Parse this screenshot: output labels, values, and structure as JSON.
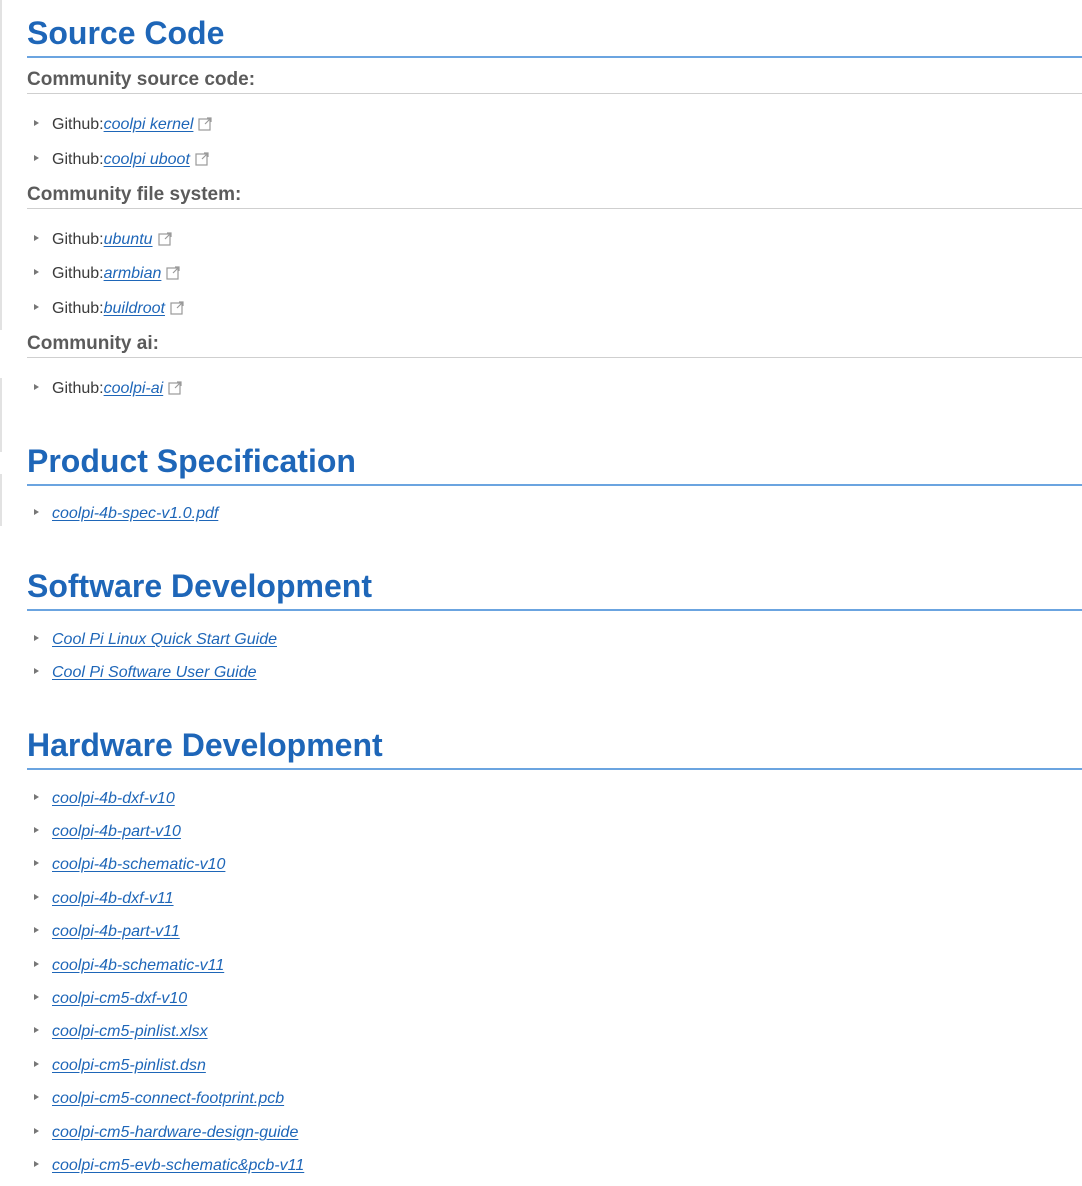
{
  "sections": {
    "source_code": {
      "title": "Source Code",
      "community_source_code": {
        "heading": "Community source code:",
        "items": [
          {
            "prefix": "Github:",
            "label": "coolpi kernel"
          },
          {
            "prefix": "Github:",
            "label": "coolpi uboot"
          }
        ]
      },
      "community_file_system": {
        "heading": "Community file system:",
        "items": [
          {
            "prefix": "Github:",
            "label": "ubuntu"
          },
          {
            "prefix": "Github:",
            "label": "armbian"
          },
          {
            "prefix": "Github:",
            "label": "buildroot"
          }
        ]
      },
      "community_ai": {
        "heading": "Community ai:",
        "items": [
          {
            "prefix": "Github:",
            "label": "coolpi-ai"
          }
        ]
      }
    },
    "product_specification": {
      "title": "Product Specification",
      "items": [
        {
          "label": "coolpi-4b-spec-v1.0.pdf"
        }
      ]
    },
    "software_development": {
      "title": "Software Development",
      "items": [
        {
          "label": "Cool Pi Linux Quick Start Guide"
        },
        {
          "label": "Cool Pi Software User Guide"
        }
      ]
    },
    "hardware_development": {
      "title": "Hardware Development",
      "items": [
        {
          "label": "coolpi-4b-dxf-v10"
        },
        {
          "label": "coolpi-4b-part-v10"
        },
        {
          "label": "coolpi-4b-schematic-v10"
        },
        {
          "label": "coolpi-4b-dxf-v11"
        },
        {
          "label": "coolpi-4b-part-v11"
        },
        {
          "label": "coolpi-4b-schematic-v11"
        },
        {
          "label": "coolpi-cm5-dxf-v10"
        },
        {
          "label": "coolpi-cm5-pinlist.xlsx"
        },
        {
          "label": "coolpi-cm5-pinlist.dsn"
        },
        {
          "label": "coolpi-cm5-connect-footprint.pcb"
        },
        {
          "label": "coolpi-cm5-hardware-design-guide"
        },
        {
          "label": "coolpi-cm5-evb-schematic&pcb-v11"
        }
      ]
    }
  },
  "icons": {
    "bullet": "triangle-right-icon",
    "external": "external-link-icon"
  },
  "colors": {
    "heading": "#1e66b8",
    "link": "#1e66b8",
    "heading_rule": "#6ba4e0",
    "subheading": "#5b5b5b"
  }
}
